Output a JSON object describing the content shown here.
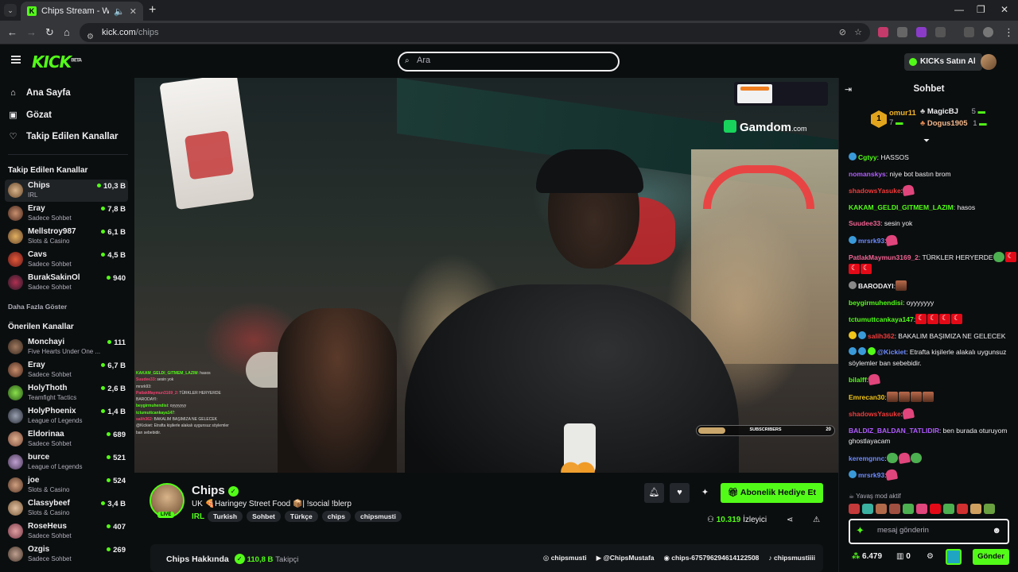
{
  "browser": {
    "tab_title": "Chips Stream - Watch Live ...",
    "url_domain": "kick.com",
    "url_path": "/chips"
  },
  "header": {
    "logo": "KICK",
    "logo_beta": "BETA",
    "search_placeholder": "Ara",
    "buy_kicks": "KICKs Satın Al"
  },
  "sidebar": {
    "nav": [
      {
        "label": "Ana Sayfa",
        "icon": "home-icon"
      },
      {
        "label": "Gözat",
        "icon": "browse-icon"
      },
      {
        "label": "Takip Edilen Kanallar",
        "icon": "heart-icon"
      }
    ],
    "followed_title": "Takip Edilen Kanallar",
    "followed": [
      {
        "name": "Chips",
        "category": "IRL",
        "viewers": "10,3 B"
      },
      {
        "name": "Eray",
        "category": "Sadece Sohbet",
        "viewers": "7,8 B"
      },
      {
        "name": "Mellstroy987",
        "category": "Slots & Casino",
        "viewers": "6,1 B"
      },
      {
        "name": "Cavs",
        "category": "Sadece Sohbet",
        "viewers": "4,5 B"
      },
      {
        "name": "BurakSakinOl",
        "category": "Sadece Sohbet",
        "viewers": "940"
      }
    ],
    "show_more": "Daha Fazla Göster",
    "recommended_title": "Önerilen Kanallar",
    "recommended": [
      {
        "name": "Monchayi",
        "category": "Five Hearts Under One ...",
        "viewers": "111"
      },
      {
        "name": "Eray",
        "category": "Sadece Sohbet",
        "viewers": "6,7 B"
      },
      {
        "name": "HolyThoth",
        "category": "Teamfight Tactics",
        "viewers": "2,6 B"
      },
      {
        "name": "HolyPhoenix",
        "category": "League of Legends",
        "viewers": "1,4 B"
      },
      {
        "name": "Eldorinaa",
        "category": "Sadece Sohbet",
        "viewers": "689"
      },
      {
        "name": "burce",
        "category": "League of Legends",
        "viewers": "521"
      },
      {
        "name": "joe",
        "category": "Slots & Casino",
        "viewers": "524"
      },
      {
        "name": "Classybeef",
        "category": "Slots & Casino",
        "viewers": "3,4 B"
      },
      {
        "name": "RoseHeus",
        "category": "Sadece Sohbet",
        "viewers": "407"
      },
      {
        "name": "Ozgis",
        "category": "Sadece Sohbet",
        "viewers": "269"
      }
    ]
  },
  "video": {
    "sponsor": "Gamdom",
    "sponsor_suffix": ".com",
    "sub_goal_label": "SUBSCRIBERS",
    "sub_goal_count": "20",
    "sub_goal_progress": 0.2,
    "overlay_chat": [
      {
        "user": "KAKAM_GELDI_GITMEM_LAZIM",
        "text": ": hasos"
      },
      {
        "user": "Suudee33",
        "text": ": sesin yok"
      },
      {
        "user": "mrsrk93",
        "text": ":"
      },
      {
        "user": "PatlakMaymun3169_2",
        "text": ": TÜRKLER HERYERDE"
      },
      {
        "user": "BARODAYI",
        "text": ":"
      },
      {
        "user": "beygirmuhendisi",
        "text": ": oyyyyyyy"
      },
      {
        "user": "tctumuttcankaya147",
        "text": ":"
      },
      {
        "user": "salih362",
        "text": ": BAKALIM BAŞIMIZA NE GELECEK"
      },
      {
        "user": "@Kickiet",
        "text": ": Etrafta kişilerle alakalı uygunsuz söylemler"
      },
      {
        "user": "",
        "text": "ban sebebidir."
      }
    ]
  },
  "stream": {
    "name": "Chips",
    "live": "LIVE",
    "title": "UK 🍕Haringey Street Food 📦| !social !blerp",
    "category": "IRL",
    "tags": [
      "Turkish",
      "Sohbet",
      "Türkçe",
      "chips",
      "chipsmusti"
    ],
    "gift_button": "Abonelik Hediye Et",
    "viewers": "10.319",
    "viewers_label": "İzleyici",
    "about": "Chips Hakkında",
    "followers": "110,8 B",
    "followers_label": "Takipçi",
    "socials": [
      "chipsmusti",
      "@ChipsMustafa",
      "chips-675796294614122508",
      "chipsmustiiii"
    ]
  },
  "chat": {
    "title": "Sohbet",
    "top_gifters": [
      {
        "name": "omur11",
        "count": "7"
      },
      {
        "name": "MagicBJ",
        "count": "5"
      },
      {
        "name": "Dogus1905",
        "count": "1"
      }
    ],
    "messages": [
      {
        "user": "Cgtyy",
        "text": ": HASSOS",
        "color": "#53fc18"
      },
      {
        "user": "nomanskys",
        "text": ": niye bot bastın brom",
        "color": "#b05cff"
      },
      {
        "user": "shadowsYasuke",
        "text": ":",
        "color": "#f03a3a"
      },
      {
        "user": "KAKAM_GELDI_GITMEM_LAZIM",
        "text": ": hasos",
        "color": "#53fc18"
      },
      {
        "user": "Suudee33",
        "text": ": sesin yok",
        "color": "#f06292"
      },
      {
        "user": "mrsrk93",
        "text": ":",
        "color": "#6d8bff"
      },
      {
        "user": "PatlakMaymun3169_2",
        "text": ": TÜRKLER HERYERDE",
        "color": "#f06292"
      },
      {
        "user": "BARODAYI",
        "text": ":",
        "color": "#efeff1"
      },
      {
        "user": "beygirmuhendisi",
        "text": ": oyyyyyyy",
        "color": "#53fc18"
      },
      {
        "user": "tctumuttcankaya147",
        "text": ":",
        "color": "#53fc18"
      },
      {
        "user": "salih362",
        "text": ": BAKALIM BAŞIMIZA NE GELECEK",
        "color": "#f03a3a"
      },
      {
        "user": "@Kickiet",
        "text": ": Etrafta kişilerle alakalı uygunsuz söylemler ban sebebidir.",
        "color": "#6d8bff"
      },
      {
        "user": "bilalff",
        "text": ":",
        "color": "#53fc18"
      },
      {
        "user": "Emrecan30",
        "text": ":",
        "color": "#f0c419"
      },
      {
        "user": "shadowsYasuke",
        "text": ":",
        "color": "#f03a3a"
      },
      {
        "user": "BALDIZ_BALDAN_TATLIDIR",
        "text": ": ben burada oturuyom ghostlayacam",
        "color": "#b05cff"
      },
      {
        "user": "keremgnnc",
        "text": ":",
        "color": "#6d8bff"
      },
      {
        "user": "mrsrk93",
        "text": ":",
        "color": "#6d8bff"
      }
    ],
    "slow_mode": "Yavaş mod aktif",
    "input_placeholder": "mesaj gönderin",
    "kicks_balance": "6.479",
    "gift_count": "0",
    "send": "Gönder"
  },
  "colors": {
    "accent": "#53fc18",
    "background": "#0b0e0f"
  }
}
